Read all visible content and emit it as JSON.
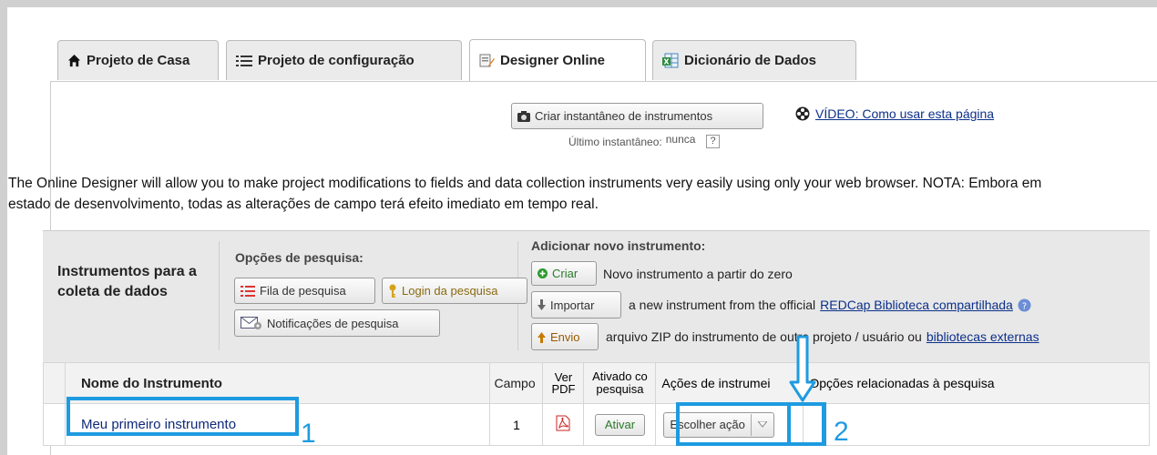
{
  "tabs": [
    {
      "label": "Projeto de Casa",
      "icon": "home-icon"
    },
    {
      "label": "Projeto de configuração",
      "icon": "list-icon"
    },
    {
      "label": "Designer Online",
      "icon": "designer-icon",
      "active": true
    },
    {
      "label": "Dicionário de Dados",
      "icon": "spreadsheet-icon"
    }
  ],
  "snapshot": {
    "button_label": "Criar instantâneo de instrumentos",
    "last_label": "Último instantâneo:",
    "last_value": "nunca",
    "help": "?"
  },
  "video_link": "VÍDEO: Como usar esta página",
  "description": "The Online Designer will allow you to make project modifications to fields and data collection instruments very easily using only your web browser. NOTA: Embora em estado de desenvolvimento, todas as alterações de campo terá efeito imediato em tempo real.",
  "panel": {
    "title": "Instrumentos para a coleta de dados",
    "survey_options_label": "Opções de pesquisa:",
    "survey_queue": "Fila de pesquisa",
    "survey_login": "Login da pesquisa",
    "survey_notifications": "Notificações de pesquisa",
    "add_label": "Adicionar novo instrumento:",
    "create_btn": "Criar",
    "create_text": "Novo instrumento a partir do zero",
    "import_btn": "Importar",
    "import_text": "a new instrument from the official",
    "import_link": "REDCap Biblioteca compartilhada",
    "upload_btn": "Envio",
    "upload_text": "arquivo ZIP do instrumento de outro projeto / usuário ou",
    "upload_link": "bibliotecas externas"
  },
  "table": {
    "headers": {
      "name": "Nome do Instrumento",
      "fields": "Campo",
      "pdf": "Ver PDF",
      "enabled": "Ativado co pesquisa",
      "actions": "Ações de instrumei",
      "survey_opts": "Opções relacionadas à pesquisa"
    },
    "rows": [
      {
        "name": "Meu primeiro instrumento",
        "fields": "1",
        "enable_btn": "Ativar",
        "action_select": "Escolher ação"
      }
    ]
  },
  "annotations": {
    "marker1": "1",
    "marker2": "2"
  },
  "colors": {
    "highlight": "#1e9be0",
    "link": "#0b2f8a",
    "create_green": "#2a9a2a"
  }
}
